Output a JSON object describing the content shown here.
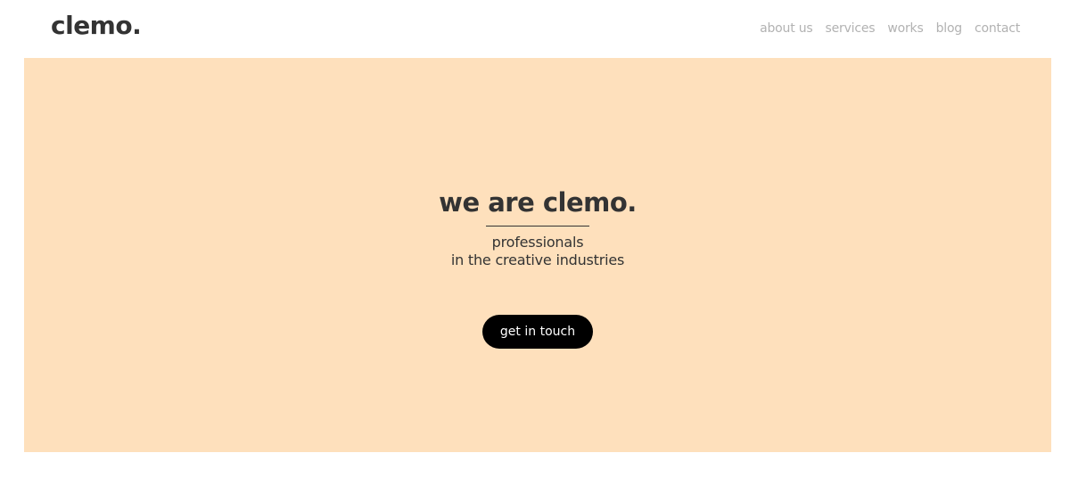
{
  "header": {
    "logo": "clemo.",
    "nav": [
      {
        "label": "about us"
      },
      {
        "label": "services"
      },
      {
        "label": "works"
      },
      {
        "label": "blog"
      },
      {
        "label": "contact"
      }
    ]
  },
  "hero": {
    "title": "we are clemo.",
    "subtitle_line1": "professionals",
    "subtitle_line2": "in the creative industries",
    "cta_label": "get in touch"
  },
  "colors": {
    "hero_background": "#fee0bc",
    "text_dark": "#333333",
    "nav_text": "#b2b2b2",
    "button_background": "#000000",
    "button_text": "#ffffff"
  }
}
